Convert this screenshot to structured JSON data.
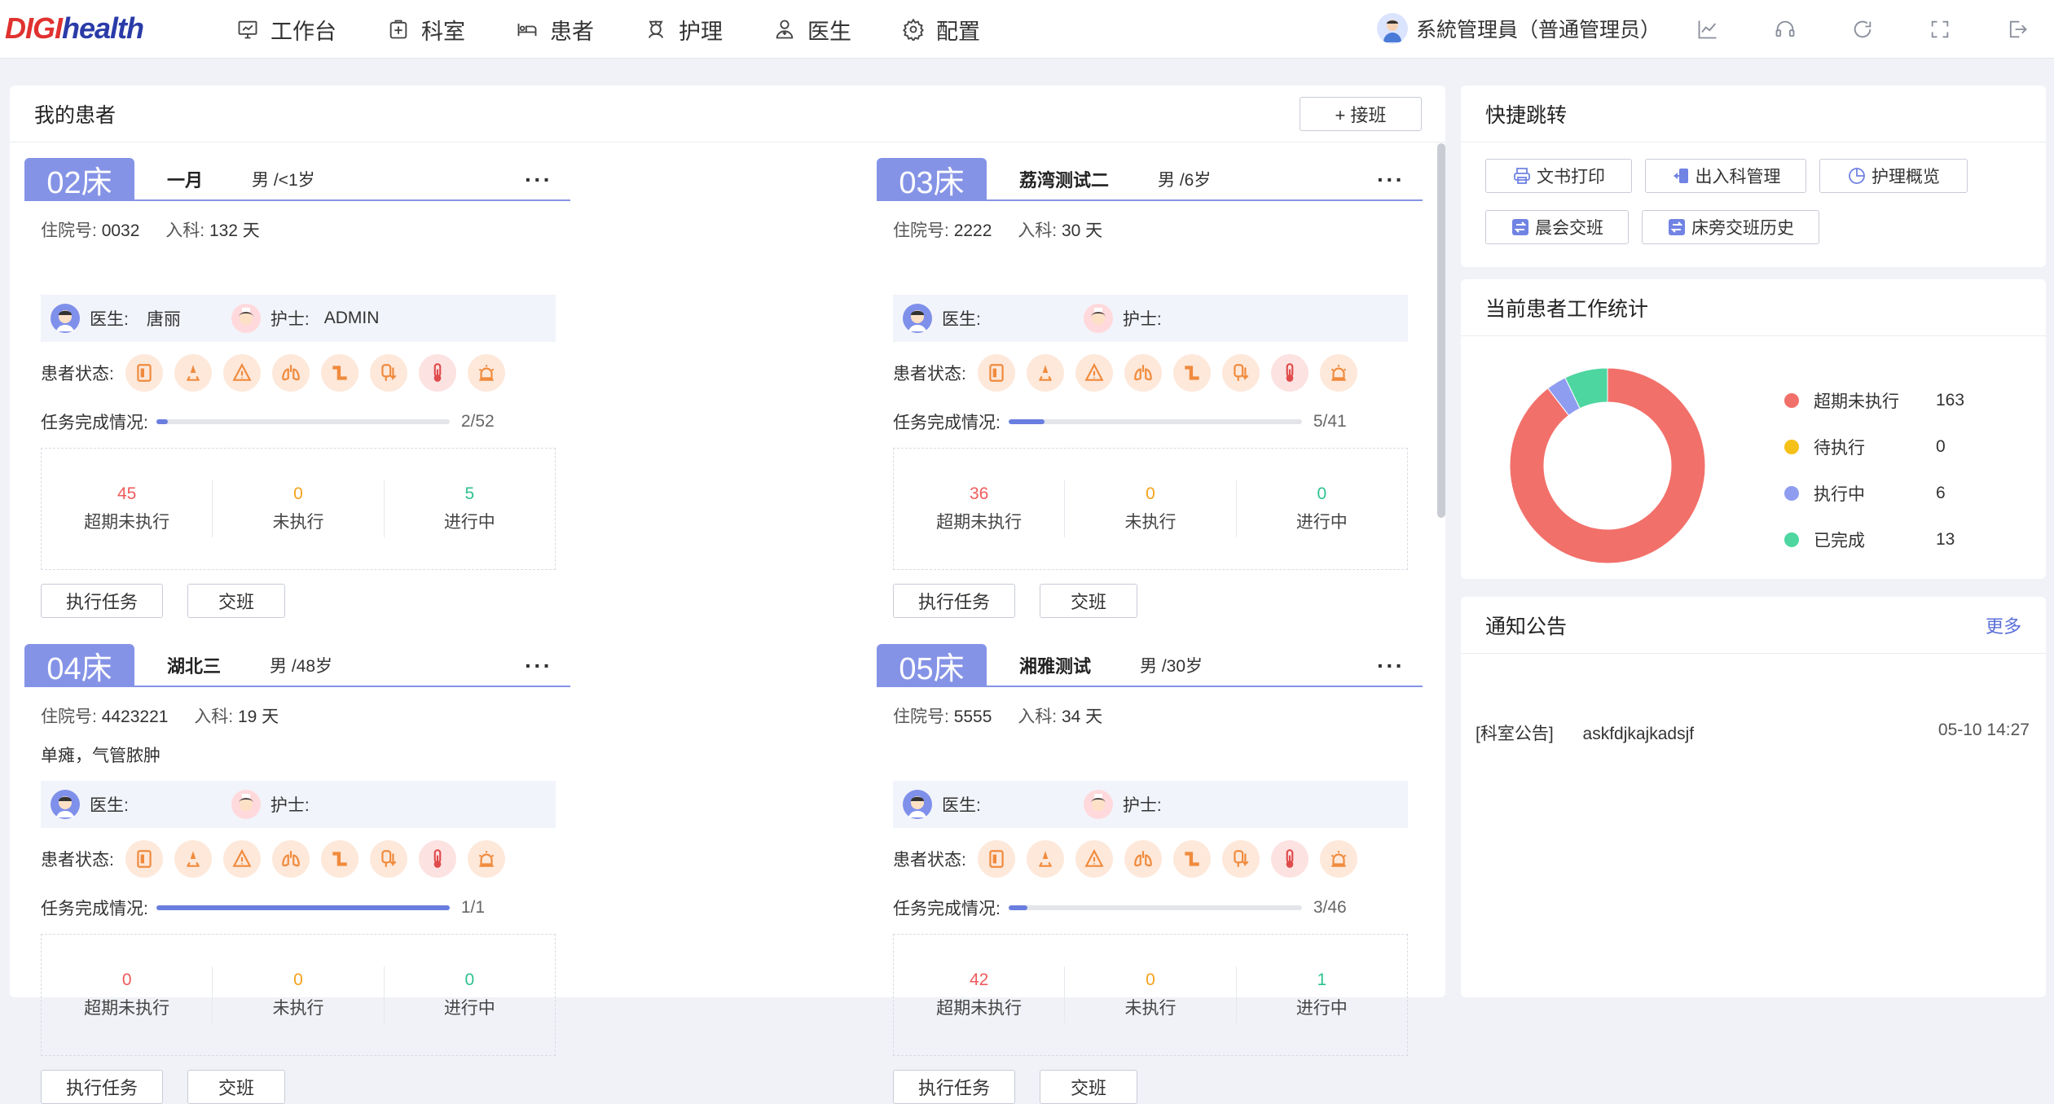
{
  "app": {
    "logo_prefix": "DIGI",
    "logo_suffix": "health",
    "nav": [
      {
        "label": "工作台",
        "icon": "monitor-chart-icon"
      },
      {
        "label": "科室",
        "icon": "hospital-box-icon"
      },
      {
        "label": "患者",
        "icon": "bed-icon"
      },
      {
        "label": "护理",
        "icon": "nurse-icon"
      },
      {
        "label": "医生",
        "icon": "doctor-icon"
      },
      {
        "label": "配置",
        "icon": "gear-icon"
      }
    ],
    "user": "系統管理員（普通管理员）",
    "tools": [
      "trend-chart-icon",
      "headset-icon",
      "refresh-icon",
      "fullscreen-icon",
      "logout-icon"
    ]
  },
  "patients_panel": {
    "title": "我的患者",
    "handover_button": "+ 接班",
    "status_label": "患者状态:",
    "progress_label": "任务完成情况:",
    "hosp_label": "住院号:",
    "admit_label": "入科:",
    "doctor_label": "医生:",
    "nurse_label": "护士:",
    "stat_labels": [
      "超期未执行",
      "未执行",
      "进行中"
    ],
    "exec_button": "执行任务",
    "shift_button": "交班",
    "more_icon": "···",
    "status_icons": [
      "bed-card-icon",
      "fall-risk-icon",
      "warning-icon",
      "lungs-icon",
      "pipe-icon",
      "iv-drip-icon",
      "thermometer-icon",
      "alarm-icon"
    ],
    "cards": [
      {
        "bed": "02床",
        "name": "一月",
        "info": "男 /<1岁",
        "hosp_no": "0032",
        "admit": "132 天",
        "diagnosis": "",
        "doctor": "唐丽",
        "nurse": "ADMIN",
        "progress_text": "2/52",
        "progress": 0.038,
        "stats": [
          "45",
          "0",
          "5"
        ]
      },
      {
        "bed": "03床",
        "name": "荔湾测试二",
        "info": "男 /6岁",
        "hosp_no": "2222",
        "admit": "30 天",
        "diagnosis": "",
        "doctor": "",
        "nurse": "",
        "progress_text": "5/41",
        "progress": 0.122,
        "stats": [
          "36",
          "0",
          "0"
        ]
      },
      {
        "bed": "04床",
        "name": "湖北三",
        "info": "男 /48岁",
        "hosp_no": "4423221",
        "admit": "19 天",
        "diagnosis": "单瘫，气管脓肿",
        "doctor": "",
        "nurse": "",
        "progress_text": "1/1",
        "progress": 1.0,
        "stats": [
          "0",
          "0",
          "0"
        ]
      },
      {
        "bed": "05床",
        "name": "湘雅测试",
        "info": "男 /30岁",
        "hosp_no": "5555",
        "admit": "34 天",
        "diagnosis": "",
        "doctor": "",
        "nurse": "",
        "progress_text": "3/46",
        "progress": 0.065,
        "stats": [
          "42",
          "0",
          "1"
        ]
      }
    ]
  },
  "quick_jump": {
    "title": "快捷跳转",
    "buttons": [
      {
        "label": "文书打印",
        "icon": "printer-icon"
      },
      {
        "label": "出入科管理",
        "icon": "transfer-icon"
      },
      {
        "label": "护理概览",
        "icon": "pie-icon"
      },
      {
        "label": "晨会交班",
        "icon": "swap-icon"
      },
      {
        "label": "床旁交班历史",
        "icon": "swap-icon"
      }
    ]
  },
  "stats_panel": {
    "title": "当前患者工作统计"
  },
  "chart_data": {
    "type": "pie",
    "title": "",
    "categories": [
      "超期未执行",
      "待执行",
      "执行中",
      "已完成"
    ],
    "values": [
      163,
      0,
      6,
      13
    ],
    "colors": [
      "#f2706a",
      "#f5c018",
      "#8f9df0",
      "#4dd6a0"
    ],
    "legend": "right"
  },
  "notice": {
    "title": "通知公告",
    "more": "更多",
    "items": [
      {
        "tag": "[科室公告]",
        "text": "askfdjkajkadsjf",
        "time": "05-10 14:27"
      }
    ]
  }
}
